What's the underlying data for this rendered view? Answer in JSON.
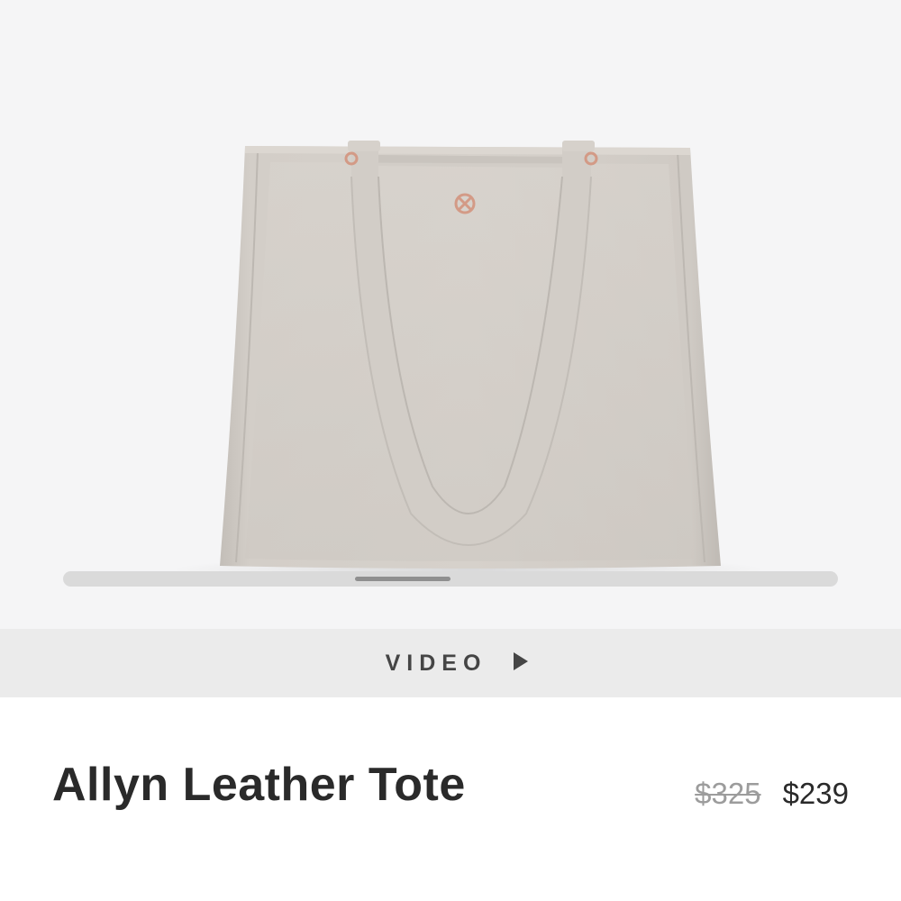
{
  "gallery": {
    "image_alt": "Allyn Leather Tote",
    "bag_color": "#cfcac4",
    "hardware_color": "#d39a86",
    "background_color": "#f5f5f6",
    "scroll_position": 0.43
  },
  "video_bar": {
    "label": "VIDEO",
    "icon": "play-icon"
  },
  "product": {
    "title": "Allyn Leather Tote",
    "original_price": "$325",
    "sale_price": "$239"
  }
}
